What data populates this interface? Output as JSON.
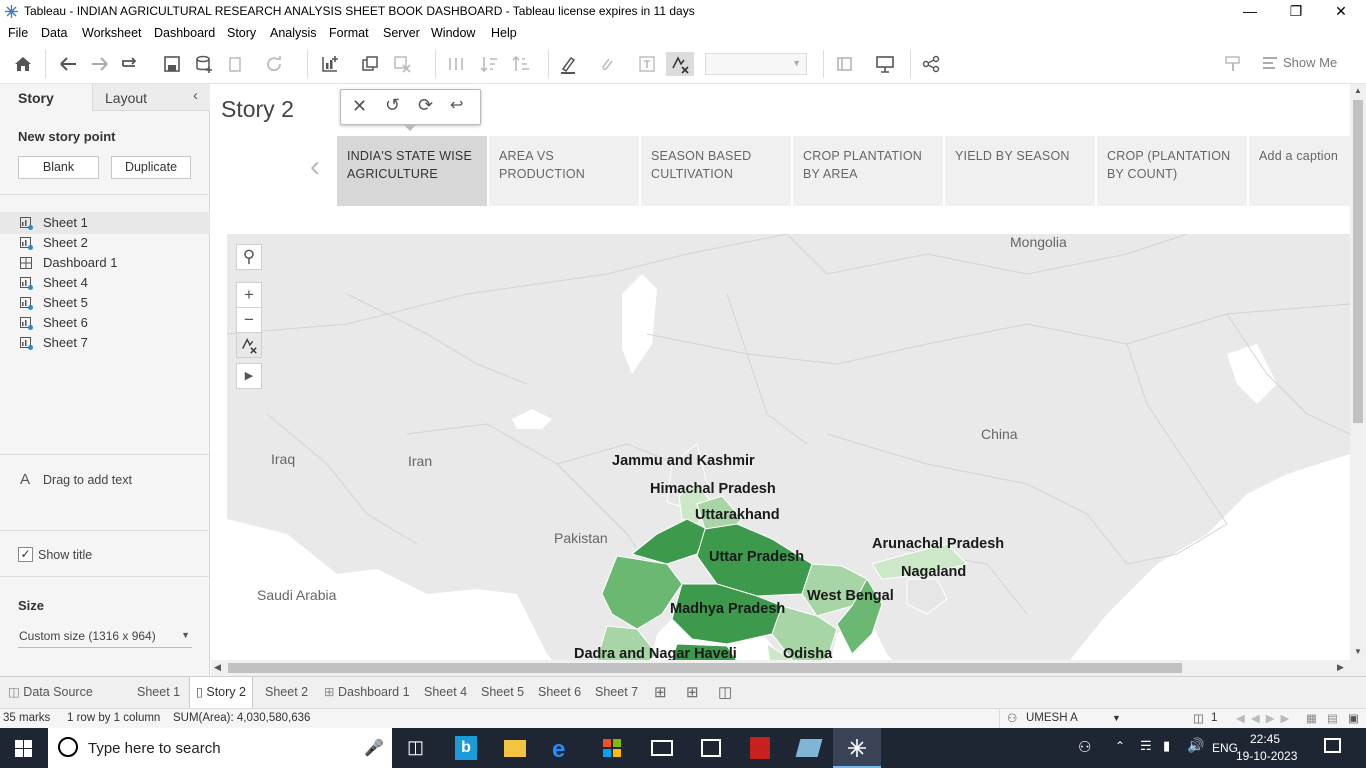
{
  "window": {
    "title": "Tableau - INDIAN AGRICULTURAL RESEARCH ANALYSIS SHEET BOOK DASHBOARD - Tableau license expires in 11 days"
  },
  "menu": [
    "File",
    "Data",
    "Worksheet",
    "Dashboard",
    "Story",
    "Analysis",
    "Format",
    "Server",
    "Window",
    "Help"
  ],
  "toolbar": {
    "show_me": "Show Me"
  },
  "left_panel": {
    "tab_story": "Story",
    "tab_layout": "Layout",
    "new_story_point": "New story point",
    "blank": "Blank",
    "duplicate": "Duplicate",
    "sheets": [
      "Sheet 1",
      "Sheet 2",
      "Dashboard 1",
      "Sheet 4",
      "Sheet 5",
      "Sheet 6",
      "Sheet 7"
    ],
    "drag_text": "Drag to add text",
    "show_title": "Show title",
    "size_label": "Size",
    "size_value": "Custom size (1316 x 964)"
  },
  "story": {
    "title": "Story 2",
    "points": [
      "INDIA'S STATE WISE AGRICULTURE",
      "AREA VS PRODUCTION",
      "SEASON BASED CULTIVATION",
      "CROP PLANTATION BY AREA",
      "YIELD BY SEASON",
      "CROP (PLANTATION BY COUNT)",
      "Add a caption"
    ],
    "active_index": 0
  },
  "map": {
    "countries": [
      "Mongolia",
      "China",
      "Iran",
      "Iraq",
      "Pakistan",
      "Saudi Arabia"
    ],
    "states": [
      "Jammu and Kashmir",
      "Himachal Pradesh",
      "Uttarakhand",
      "Uttar Pradesh",
      "Arunachal Pradesh",
      "Nagaland",
      "West Bengal",
      "Madhya Pradesh",
      "Dadra and Nagar Haveli",
      "Odisha"
    ],
    "colors": {
      "dark": "#3d9a4c",
      "mid": "#6ab872",
      "light": "#a8d5a6",
      "pale": "#cde8c9",
      "sea": "#ffffff",
      "land": "#e9e9e9"
    }
  },
  "tabs": {
    "data_source": "Data Source",
    "sheets": [
      "Sheet 1",
      "Story 2",
      "Sheet 2",
      "Dashboard 1",
      "Sheet 4",
      "Sheet 5",
      "Sheet 6",
      "Sheet 7"
    ],
    "current": "Story 2"
  },
  "status": {
    "marks": "35 marks",
    "rows_cols": "1 row by 1 column",
    "sum": "SUM(Area): 4,030,580,636",
    "user": "UMESH A",
    "page": "1"
  },
  "taskbar": {
    "search_placeholder": "Type here to search",
    "lang": "ENG",
    "time": "22:45",
    "date": "19-10-2023"
  }
}
